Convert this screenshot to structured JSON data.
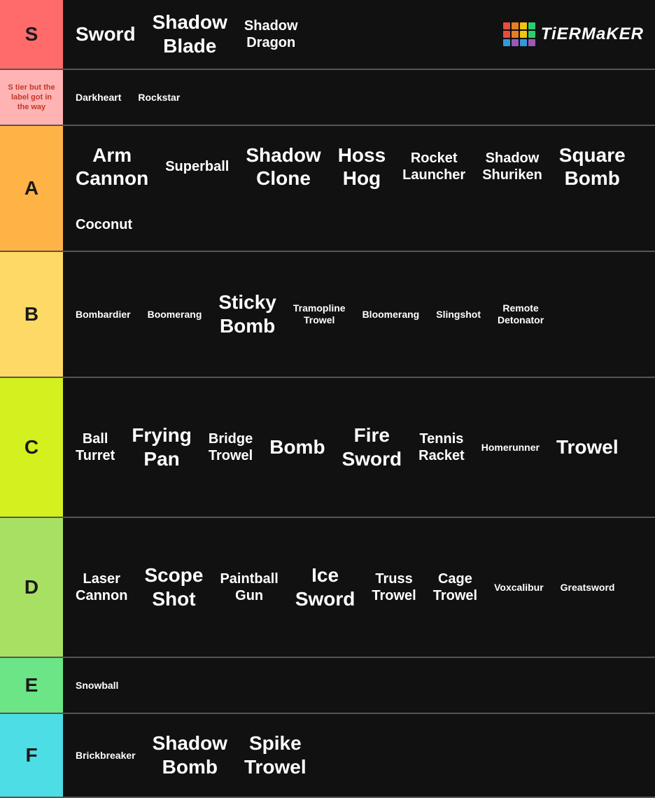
{
  "tiers": [
    {
      "id": "s",
      "label": "S",
      "labelType": "normal",
      "color": "s-tier",
      "items": [
        {
          "text": "Sword",
          "size": "large"
        },
        {
          "text": "Shadow Blade",
          "size": "large"
        },
        {
          "text": "Shadow Dragon",
          "size": "medium"
        }
      ],
      "hasLogo": true,
      "logoColors": [
        "#e74c3c",
        "#e67e22",
        "#f1c40f",
        "#2ecc71",
        "#3498db",
        "#9b59b6",
        "#e74c3c",
        "#e67e22",
        "#f1c40f",
        "#2ecc71",
        "#3498db",
        "#9b59b6"
      ]
    },
    {
      "id": "s-note",
      "label": "S tier but the label got in the way",
      "labelType": "small",
      "color": "s-tier-note",
      "items": [
        {
          "text": "Darkheart",
          "size": "small"
        },
        {
          "text": "Rockstar",
          "size": "small"
        }
      ]
    },
    {
      "id": "a",
      "label": "A",
      "labelType": "normal",
      "color": "a-tier",
      "items": [
        {
          "text": "Arm Cannon",
          "size": "large"
        },
        {
          "text": "Superball",
          "size": "medium"
        },
        {
          "text": "Shadow Clone",
          "size": "large"
        },
        {
          "text": "Hoss Hog",
          "size": "large"
        },
        {
          "text": "Rocket Launcher",
          "size": "medium"
        },
        {
          "text": "Shadow Shuriken",
          "size": "medium"
        },
        {
          "text": "Square Bomb",
          "size": "large"
        },
        {
          "text": "Coconut",
          "size": "medium"
        }
      ]
    },
    {
      "id": "b",
      "label": "B",
      "labelType": "normal",
      "color": "b-tier",
      "items": [
        {
          "text": "Bombardier",
          "size": "small"
        },
        {
          "text": "Boomerang",
          "size": "small"
        },
        {
          "text": "Sticky Bomb",
          "size": "large"
        },
        {
          "text": "Tramopline Trowel",
          "size": "small"
        },
        {
          "text": "Bloomerang",
          "size": "small"
        },
        {
          "text": "Slingshot",
          "size": "small"
        },
        {
          "text": "Remote Detonator",
          "size": "small"
        }
      ]
    },
    {
      "id": "c",
      "label": "C",
      "labelType": "normal",
      "color": "c-tier",
      "items": [
        {
          "text": "Ball Turret",
          "size": "medium"
        },
        {
          "text": "Frying Pan",
          "size": "large"
        },
        {
          "text": "Bridge Trowel",
          "size": "medium"
        },
        {
          "text": "Bomb",
          "size": "large"
        },
        {
          "text": "Fire Sword",
          "size": "large"
        },
        {
          "text": "Tennis Racket",
          "size": "medium"
        },
        {
          "text": "Homerunner",
          "size": "small"
        },
        {
          "text": "Trowel",
          "size": "large"
        }
      ]
    },
    {
      "id": "d",
      "label": "D",
      "labelType": "normal",
      "color": "d-tier",
      "items": [
        {
          "text": "Laser Cannon",
          "size": "medium"
        },
        {
          "text": "Scope Shot",
          "size": "large"
        },
        {
          "text": "Paintball Gun",
          "size": "medium"
        },
        {
          "text": "Ice Sword",
          "size": "large"
        },
        {
          "text": "Truss Trowel",
          "size": "medium"
        },
        {
          "text": "Cage Trowel",
          "size": "medium"
        },
        {
          "text": "Voxcalibur",
          "size": "small"
        },
        {
          "text": "Greatsword",
          "size": "small"
        }
      ]
    },
    {
      "id": "e",
      "label": "E",
      "labelType": "normal",
      "color": "e-tier",
      "items": [
        {
          "text": "Snowball",
          "size": "small"
        }
      ]
    },
    {
      "id": "f",
      "label": "F",
      "labelType": "normal",
      "color": "f-tier",
      "items": [
        {
          "text": "Brickbreaker",
          "size": "small"
        },
        {
          "text": "Shadow Bomb",
          "size": "large"
        },
        {
          "text": "Spike Trowel",
          "size": "large"
        }
      ]
    }
  ],
  "logo": {
    "text": "TiERMaKER"
  }
}
